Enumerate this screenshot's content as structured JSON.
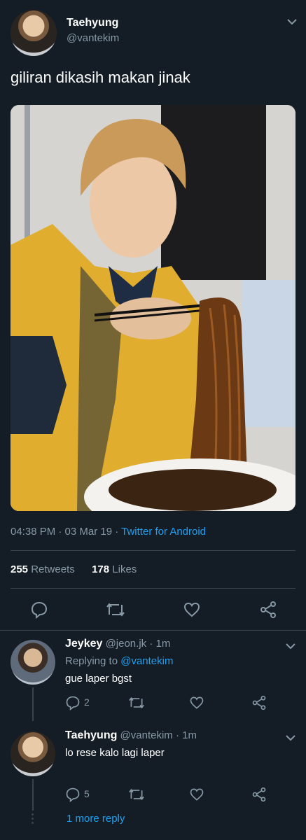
{
  "tweet": {
    "author_name": "Taehyung",
    "author_handle": "@vantekim",
    "text": "giliran dikasih makan jinak",
    "timestamp": "04:38 PM · 03 Mar 19 · ",
    "source": "Twitter for Android",
    "retweets_count": "255",
    "retweets_label": "Retweets",
    "likes_count": "178",
    "likes_label": "Likes"
  },
  "replies": [
    {
      "author_name": "Jeykey",
      "author_handle": "@jeon.jk · 1m",
      "replying_prefix": "Replying to ",
      "replying_to": "@vantekim",
      "text": "gue laper bgst",
      "reply_count": "2"
    },
    {
      "author_name": "Taehyung",
      "author_handle": "@vantekim · 1m",
      "text": "lo rese kalo lagi laper",
      "reply_count": "5"
    }
  ],
  "more_replies": "1 more reply",
  "colors": {
    "background": "#141d26",
    "accent": "#1da1f2",
    "muted": "#8899a6",
    "divider": "#38444d"
  },
  "icons": [
    "chevron-down-icon",
    "reply-icon",
    "retweet-icon",
    "like-icon",
    "share-icon"
  ]
}
